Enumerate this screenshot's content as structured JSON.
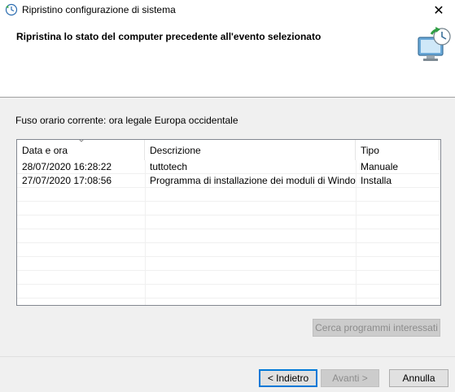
{
  "window": {
    "title": "Ripristino configurazione di sistema",
    "close_symbol": "✕"
  },
  "header": {
    "heading": "Ripristina lo stato del computer precedente all'evento selezionato",
    "icon": "system-restore-icon"
  },
  "timezone_text": "Fuso orario corrente: ora legale Europa occidentale",
  "table": {
    "columns": [
      "Data e ora",
      "Descrizione",
      "Tipo"
    ],
    "rows": [
      {
        "date": "28/07/2020 16:28:22",
        "description": "tuttotech",
        "type": "Manuale"
      },
      {
        "date": "27/07/2020 17:08:56",
        "description": "Programma di installazione dei moduli di Windows",
        "type": "Installa"
      }
    ],
    "sort_column": "Data e ora"
  },
  "buttons": {
    "scan": "Cerca programmi interessati",
    "back": "< Indietro",
    "next": "Avanti >",
    "cancel": "Annulla"
  },
  "colors": {
    "accent": "#0078d7",
    "background": "#f0f0f0",
    "disabled_text": "#8c8c8c"
  }
}
